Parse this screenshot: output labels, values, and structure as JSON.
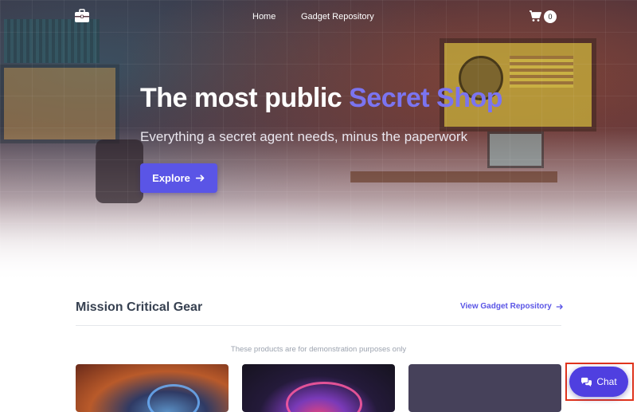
{
  "nav": {
    "links": [
      {
        "label": "Home"
      },
      {
        "label": "Gadget Repository"
      }
    ],
    "cart_count": "0"
  },
  "hero": {
    "headline_main": "The most public ",
    "headline_accent": "Secret Shop",
    "subheadline": "Everything a secret agent needs, minus the paperwork",
    "cta_label": "Explore"
  },
  "section": {
    "title": "Mission Critical Gear",
    "link_label": "View Gadget Repository",
    "disclaimer": "These products are for demonstration purposes only"
  },
  "chat": {
    "label": "Chat"
  },
  "colors": {
    "accent": "#5a55e6",
    "headline_accent": "#7b74f0",
    "chat": "#4f3fe0",
    "highlight": "#e0341d"
  },
  "icons": {
    "logo": "briefcase-icon",
    "cart": "shopping-cart-icon",
    "cta_arrow": "arrow-right-icon",
    "chat": "chat-bubbles-icon"
  }
}
